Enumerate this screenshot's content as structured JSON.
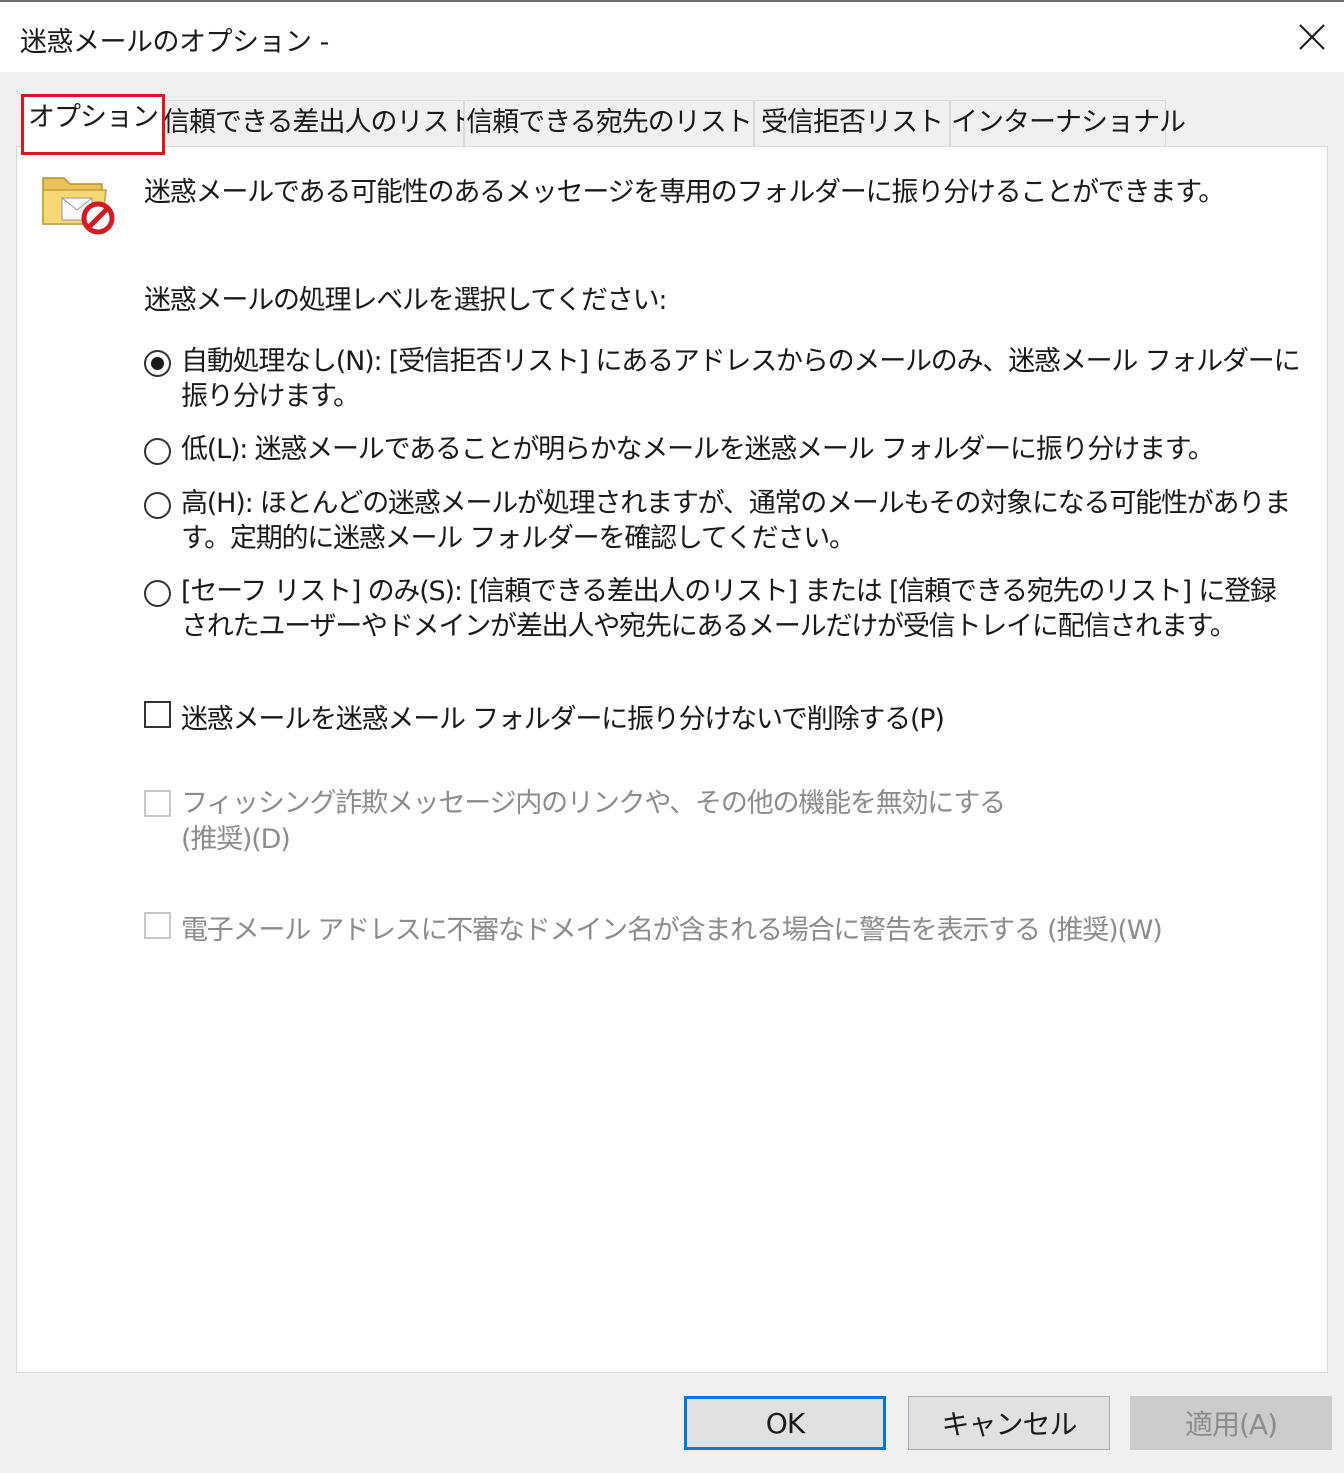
{
  "window": {
    "title": "迷惑メールのオプション -",
    "close_icon": "close-icon"
  },
  "tabs": [
    {
      "label": "オプション",
      "active": true
    },
    {
      "label": "信頼できる差出人のリスト",
      "active": false
    },
    {
      "label": "信頼できる宛先のリスト",
      "active": false
    },
    {
      "label": "受信拒否リスト",
      "active": false
    },
    {
      "label": "インターナショナル",
      "active": false
    }
  ],
  "options": {
    "icon": "junk-folder-icon",
    "description": "迷惑メールである可能性のあるメッセージを専用のフォルダーに振り分けることができます。",
    "level_prompt": "迷惑メールの処理レベルを選択してください:",
    "levels": [
      {
        "label": "自動処理なし(N): [受信拒否リスト] にあるアドレスからのメールのみ、迷惑メール フォルダーに振り分けます。",
        "selected": true
      },
      {
        "label": "低(L): 迷惑メールであることが明らかなメールを迷惑メール フォルダーに振り分けます。",
        "selected": false
      },
      {
        "label": "高(H): ほとんどの迷惑メールが処理されますが、通常のメールもその対象になる可能性があります。定期的に迷惑メール フォルダーを確認してください。",
        "selected": false
      },
      {
        "label": "[セーフ リスト] のみ(S): [信頼できる差出人のリスト] または [信頼できる宛先のリスト] に登録されたユーザーやドメインが差出人や宛先にあるメールだけが受信トレイに配信されます。",
        "selected": false
      }
    ],
    "checkboxes": [
      {
        "label": "迷惑メールを迷惑メール フォルダーに振り分けないで削除する(P)",
        "checked": false,
        "enabled": true
      },
      {
        "label": "フィッシング詐欺メッセージ内のリンクや、その他の機能を無効にする\n(推奨)(D)",
        "checked": false,
        "enabled": false
      },
      {
        "label": "電子メール アドレスに不審なドメイン名が含まれる場合に警告を表示する (推奨)(W)",
        "checked": false,
        "enabled": false
      }
    ]
  },
  "buttons": {
    "ok": "OK",
    "cancel": "キャンセル",
    "apply": "適用(A)"
  },
  "colors": {
    "highlight": "#e0141e",
    "default_button_border": "#0078d7"
  }
}
